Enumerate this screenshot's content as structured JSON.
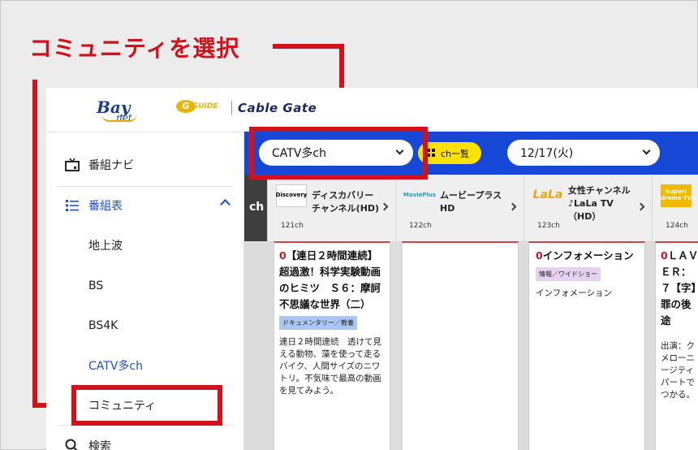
{
  "callout": {
    "text": "コミュニティを選択"
  },
  "header": {
    "bay_logo_main": "Bay",
    "bay_logo_sub": "net",
    "guide_logo_letter": "G",
    "guide_logo_text": "GUIDE",
    "cablegate_logo": "Cable Gate"
  },
  "sidebar": {
    "navi_label": "番組ナビ",
    "schedule_label": "番組表",
    "sub_items": [
      "地上波",
      "BS",
      "BS4K",
      "CATV多ch",
      "コミュニティ"
    ],
    "search_label": "検索"
  },
  "toolbar": {
    "channel_select_value": "CATV多ch",
    "ch_list_label": "ch一覧",
    "date_select_value": "12/17(火)"
  },
  "channel_header": {
    "partial_label": "ch",
    "channels": [
      {
        "logo": "Discovery",
        "name_line1": "ディスカバリー",
        "name_line2": "チャンネル(HD)",
        "number": "121ch"
      },
      {
        "logo": "MoviePlus",
        "name_line1": "ムービープラス",
        "name_line2": "HD",
        "number": "122ch"
      },
      {
        "logo": "LaLa",
        "name_line1": "女性チャンネル",
        "name_line2": "♪LaLa TV",
        "name_line3": "（HD）",
        "number": "123ch"
      },
      {
        "logo": "Super! drama TV",
        "name_line1": "",
        "name_line2": "",
        "number": "124ch"
      }
    ]
  },
  "programs": [
    {
      "minute": "0",
      "title": "【連日２時間連続】超過激！科学実験動画のヒミツ　Ｓ６：摩訶不思議な世界（二）",
      "genre": "ドキュメンタリー／教養",
      "description": "連日２時間連続　透けて見える動物、藻を使って走るバイク、人間サイズのニワトリ。不気味で最高の動画を見てみよう。"
    },
    {
      "minute": "",
      "title": "",
      "genre": "",
      "description": ""
    },
    {
      "minute": "0",
      "title": "インフォメーション",
      "genre": "情報／ワイドショー",
      "description": "インフォメーション"
    },
    {
      "minute": "0",
      "title": "ＬＡＶＥＲ：７【字】罪の後途",
      "genre": "",
      "description": "出演：クメローニージティパートでつかる。"
    }
  ],
  "colors": {
    "accent_red": "#d2111b",
    "toolbar_blue": "#1747d6",
    "ch_button_yellow": "#ffe100",
    "active_nav_blue": "#1d4ed8",
    "genre_doc_bg": "#a9c7f2",
    "genre_info_bg": "#e5d2f0"
  },
  "icons": [
    "tv-icon",
    "list-icon",
    "chevron-up-icon",
    "search-icon",
    "chevron-down-icon",
    "grid-icon",
    "chevron-right-icon"
  ]
}
